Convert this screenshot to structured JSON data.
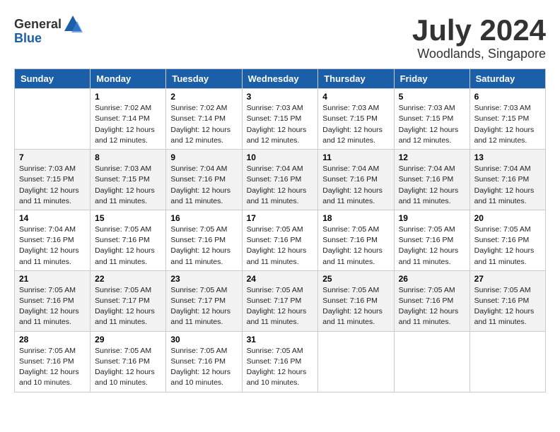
{
  "header": {
    "logo_general": "General",
    "logo_blue": "Blue",
    "month_year": "July 2024",
    "location": "Woodlands, Singapore"
  },
  "days_of_week": [
    "Sunday",
    "Monday",
    "Tuesday",
    "Wednesday",
    "Thursday",
    "Friday",
    "Saturday"
  ],
  "weeks": [
    [
      {
        "day": "",
        "info": ""
      },
      {
        "day": "1",
        "info": "Sunrise: 7:02 AM\nSunset: 7:14 PM\nDaylight: 12 hours\nand 12 minutes."
      },
      {
        "day": "2",
        "info": "Sunrise: 7:02 AM\nSunset: 7:14 PM\nDaylight: 12 hours\nand 12 minutes."
      },
      {
        "day": "3",
        "info": "Sunrise: 7:03 AM\nSunset: 7:15 PM\nDaylight: 12 hours\nand 12 minutes."
      },
      {
        "day": "4",
        "info": "Sunrise: 7:03 AM\nSunset: 7:15 PM\nDaylight: 12 hours\nand 12 minutes."
      },
      {
        "day": "5",
        "info": "Sunrise: 7:03 AM\nSunset: 7:15 PM\nDaylight: 12 hours\nand 12 minutes."
      },
      {
        "day": "6",
        "info": "Sunrise: 7:03 AM\nSunset: 7:15 PM\nDaylight: 12 hours\nand 12 minutes."
      }
    ],
    [
      {
        "day": "7",
        "info": "Sunrise: 7:03 AM\nSunset: 7:15 PM\nDaylight: 12 hours\nand 11 minutes."
      },
      {
        "day": "8",
        "info": "Sunrise: 7:03 AM\nSunset: 7:15 PM\nDaylight: 12 hours\nand 11 minutes."
      },
      {
        "day": "9",
        "info": "Sunrise: 7:04 AM\nSunset: 7:16 PM\nDaylight: 12 hours\nand 11 minutes."
      },
      {
        "day": "10",
        "info": "Sunrise: 7:04 AM\nSunset: 7:16 PM\nDaylight: 12 hours\nand 11 minutes."
      },
      {
        "day": "11",
        "info": "Sunrise: 7:04 AM\nSunset: 7:16 PM\nDaylight: 12 hours\nand 11 minutes."
      },
      {
        "day": "12",
        "info": "Sunrise: 7:04 AM\nSunset: 7:16 PM\nDaylight: 12 hours\nand 11 minutes."
      },
      {
        "day": "13",
        "info": "Sunrise: 7:04 AM\nSunset: 7:16 PM\nDaylight: 12 hours\nand 11 minutes."
      }
    ],
    [
      {
        "day": "14",
        "info": "Sunrise: 7:04 AM\nSunset: 7:16 PM\nDaylight: 12 hours\nand 11 minutes."
      },
      {
        "day": "15",
        "info": "Sunrise: 7:05 AM\nSunset: 7:16 PM\nDaylight: 12 hours\nand 11 minutes."
      },
      {
        "day": "16",
        "info": "Sunrise: 7:05 AM\nSunset: 7:16 PM\nDaylight: 12 hours\nand 11 minutes."
      },
      {
        "day": "17",
        "info": "Sunrise: 7:05 AM\nSunset: 7:16 PM\nDaylight: 12 hours\nand 11 minutes."
      },
      {
        "day": "18",
        "info": "Sunrise: 7:05 AM\nSunset: 7:16 PM\nDaylight: 12 hours\nand 11 minutes."
      },
      {
        "day": "19",
        "info": "Sunrise: 7:05 AM\nSunset: 7:16 PM\nDaylight: 12 hours\nand 11 minutes."
      },
      {
        "day": "20",
        "info": "Sunrise: 7:05 AM\nSunset: 7:16 PM\nDaylight: 12 hours\nand 11 minutes."
      }
    ],
    [
      {
        "day": "21",
        "info": "Sunrise: 7:05 AM\nSunset: 7:16 PM\nDaylight: 12 hours\nand 11 minutes."
      },
      {
        "day": "22",
        "info": "Sunrise: 7:05 AM\nSunset: 7:17 PM\nDaylight: 12 hours\nand 11 minutes."
      },
      {
        "day": "23",
        "info": "Sunrise: 7:05 AM\nSunset: 7:17 PM\nDaylight: 12 hours\nand 11 minutes."
      },
      {
        "day": "24",
        "info": "Sunrise: 7:05 AM\nSunset: 7:17 PM\nDaylight: 12 hours\nand 11 minutes."
      },
      {
        "day": "25",
        "info": "Sunrise: 7:05 AM\nSunset: 7:16 PM\nDaylight: 12 hours\nand 11 minutes."
      },
      {
        "day": "26",
        "info": "Sunrise: 7:05 AM\nSunset: 7:16 PM\nDaylight: 12 hours\nand 11 minutes."
      },
      {
        "day": "27",
        "info": "Sunrise: 7:05 AM\nSunset: 7:16 PM\nDaylight: 12 hours\nand 11 minutes."
      }
    ],
    [
      {
        "day": "28",
        "info": "Sunrise: 7:05 AM\nSunset: 7:16 PM\nDaylight: 12 hours\nand 10 minutes."
      },
      {
        "day": "29",
        "info": "Sunrise: 7:05 AM\nSunset: 7:16 PM\nDaylight: 12 hours\nand 10 minutes."
      },
      {
        "day": "30",
        "info": "Sunrise: 7:05 AM\nSunset: 7:16 PM\nDaylight: 12 hours\nand 10 minutes."
      },
      {
        "day": "31",
        "info": "Sunrise: 7:05 AM\nSunset: 7:16 PM\nDaylight: 12 hours\nand 10 minutes."
      },
      {
        "day": "",
        "info": ""
      },
      {
        "day": "",
        "info": ""
      },
      {
        "day": "",
        "info": ""
      }
    ]
  ]
}
